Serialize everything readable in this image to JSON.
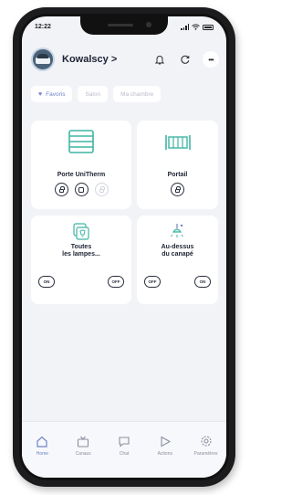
{
  "status_bar": {
    "time": "12:22"
  },
  "header": {
    "home_name": "Kowalscy",
    "chevron": ">"
  },
  "tabs": [
    {
      "label": "Favoris",
      "active": true
    },
    {
      "label": "Salon",
      "active": false
    },
    {
      "label": "Ma chambre",
      "active": false
    }
  ],
  "devices": [
    {
      "name": "Porte UniTherm",
      "icon": "garage-door-icon"
    },
    {
      "name": "Portail",
      "icon": "gate-icon"
    },
    {
      "name": "Toutes\nles lampes...",
      "icon": "lamp-group-icon",
      "off_label": "ON",
      "on_label": "OFF"
    },
    {
      "name": "Au-dessus\ndu canapé",
      "icon": "ceiling-light-icon",
      "off_label": "OFF",
      "on_label": "ON"
    }
  ],
  "tabbar": [
    {
      "label": "Home",
      "icon": "home-icon",
      "active": true
    },
    {
      "label": "Canaux",
      "icon": "tv-icon",
      "active": false
    },
    {
      "label": "Chat",
      "icon": "chat-icon",
      "active": false
    },
    {
      "label": "Actions",
      "icon": "play-icon",
      "active": false
    },
    {
      "label": "Paramètres",
      "icon": "settings-gear-icon",
      "active": false
    }
  ],
  "colors": {
    "accent": "#6f83c7",
    "icon_teal": "#3fb5a3",
    "background": "#f2f3f7"
  }
}
